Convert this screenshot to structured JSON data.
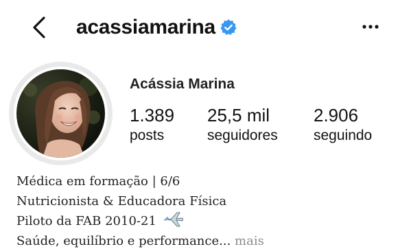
{
  "header": {
    "username": "acassiamarina",
    "verified": true,
    "icons": {
      "back": "chevron-left-icon",
      "more": "more-horizontal-icon",
      "verified": "verified-badge-icon"
    }
  },
  "profile": {
    "display_name": "Acássia Marina",
    "avatar": "profile-photo",
    "stats": [
      {
        "value": "1.389",
        "label": "posts"
      },
      {
        "value": "25,5 mil",
        "label": "seguidores"
      },
      {
        "value": "2.906",
        "label": "seguindo"
      }
    ]
  },
  "bio": {
    "line1": "Médica em formação | 6/6",
    "line2": "Nutricionista & Educadora Física",
    "line3": "Piloto da FAB 2010-21",
    "line3_emoji": "airplane-icon",
    "line4": "Saúde, equilíbrio e performance...",
    "more_label": "mais"
  },
  "colors": {
    "verified_blue": "#3897f0",
    "more_link": "#8a8a8a",
    "text": "#111111"
  }
}
